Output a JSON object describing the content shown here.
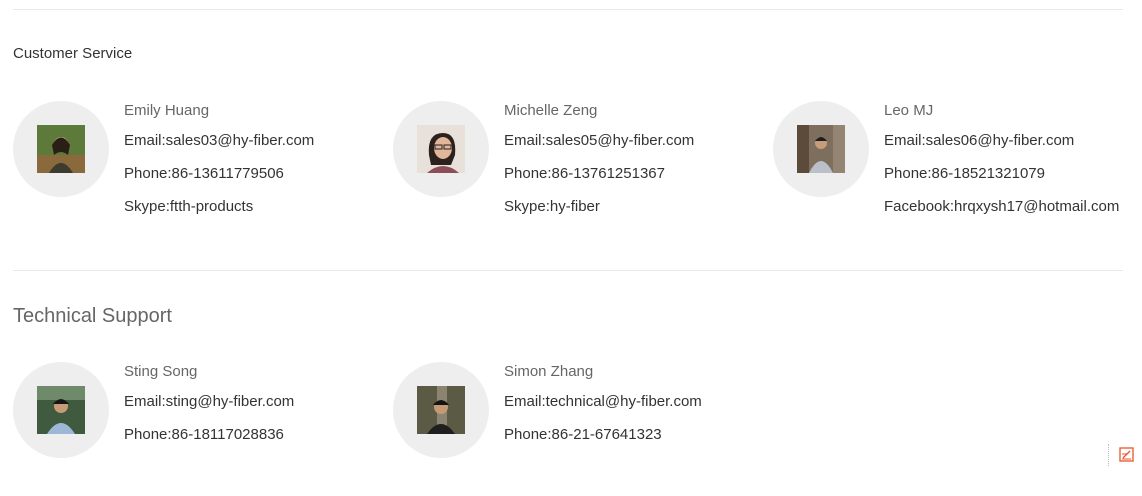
{
  "sections": [
    {
      "title": "Customer Service",
      "contacts": [
        {
          "name": "Emily Huang",
          "lines": [
            "Email:sales03@hy-fiber.com",
            "Phone:86-13611779506",
            "Skype:ftth-products"
          ]
        },
        {
          "name": "Michelle Zeng",
          "lines": [
            "Email:sales05@hy-fiber.com",
            "Phone:86-13761251367",
            "Skype:hy-fiber"
          ]
        },
        {
          "name": "Leo MJ",
          "lines": [
            "Email:sales06@hy-fiber.com",
            "Phone:86-18521321079",
            "Facebook:hrqxysh17@hotmail.com"
          ]
        }
      ]
    },
    {
      "title": "Technical Support",
      "contacts": [
        {
          "name": "Sting Song",
          "lines": [
            "Email:sting@hy-fiber.com",
            "Phone:86-18117028836"
          ]
        },
        {
          "name": "Simon Zhang",
          "lines": [
            "Email:technical@hy-fiber.com",
            "Phone:86-21-67641323"
          ]
        }
      ]
    }
  ],
  "colors": {
    "avatar_bg": "#eeeeee",
    "divider": "#e9e9e9",
    "widget_accent": "#e8542a"
  },
  "icons": {
    "corner_widget": "edit-note-icon"
  }
}
